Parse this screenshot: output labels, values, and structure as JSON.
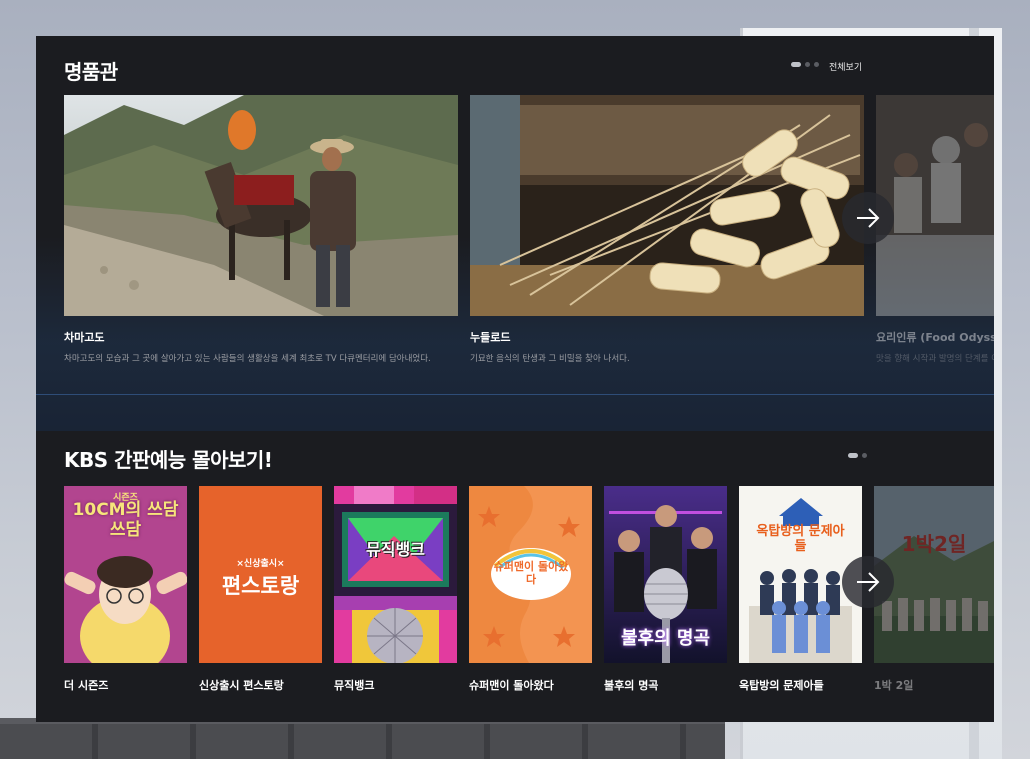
{
  "premium": {
    "title": "명품관",
    "view_all": "전체보기",
    "items": [
      {
        "title": "차마고도",
        "desc": "차마고도의 모습과 그 곳에 살아가고 있는 사람들의 생활상을 세계 최초로 TV 다큐멘터리에 담아내었다."
      },
      {
        "title": "누들로드",
        "desc": "기묘한 음식의 탄생과 그 비밀을 찾아 나서다."
      },
      {
        "title": "요리인류 (Food Odyssey)",
        "desc": "맛을 향해 시작과 발명의 단계를 이"
      }
    ]
  },
  "variety": {
    "title": "KBS 간판예능 몰아보기!",
    "items": [
      {
        "title": "더 시즌즈",
        "poster_text_top": "시즌즈",
        "poster_text": "10CM의 쓰담쓰담"
      },
      {
        "title": "신상출시 편스토랑",
        "poster_text_top": "×신상출시×",
        "poster_text": "편스토랑"
      },
      {
        "title": "뮤직뱅크",
        "poster_text": "뮤직뱅크"
      },
      {
        "title": "슈퍼맨이 돌아왔다",
        "poster_text": "슈퍼맨이 돌아왔다"
      },
      {
        "title": "불후의 명곡",
        "poster_text": "불후의 명곡"
      },
      {
        "title": "옥탑방의 문제아들",
        "poster_text": "옥탑방의 문제아들"
      },
      {
        "title": "1박 2일",
        "poster_text": "1박2일"
      }
    ]
  },
  "colors": {
    "panel": "#1b1c20",
    "accent_divider": "#2e4d78",
    "text_primary": "#ffffff",
    "text_secondary": "#9a9ca2"
  },
  "icons": {
    "next_arrow": "arrow-right-icon"
  }
}
